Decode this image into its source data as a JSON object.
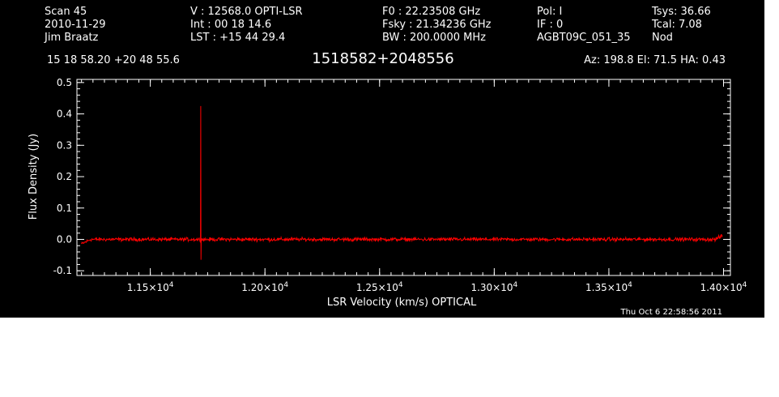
{
  "header": {
    "col1": [
      "Scan          45",
      "2010-11-29",
      "Jim Braatz"
    ],
    "col2": [
      "V   :    12568.0  OPTI-LSR",
      "Int  :   00 18 14.6",
      "LST : +15 44 29.4"
    ],
    "col3": [
      "F0    :  22.23508 GHz",
      "Fsky :  21.34236 GHz",
      "BW    : 200.0000 MHz"
    ],
    "col4": [
      "Pol:      I",
      "IF :       0",
      "AGBT09C_051_35"
    ],
    "col5": [
      "Tsys:    36.66",
      "Tcal:      7.08",
      "Nod"
    ],
    "coords": "15 18 58.20   +20 48 55.6",
    "source": "1518582+2048556",
    "azelha": "Az: 198.8   El:  71.5   HA:  0.43",
    "timestamp": "Thu Oct  6 22:58:56 2011"
  },
  "chart_data": {
    "type": "line",
    "xlabel": "LSR Velocity (km/s) OPTICAL",
    "ylabel": "Flux Density (Jy)",
    "xlim": [
      11180,
      14030
    ],
    "ylim": [
      -0.115,
      0.51
    ],
    "xticks": [
      11500,
      12000,
      12500,
      13000,
      13500,
      14000
    ],
    "xtick_labels": [
      {
        "mant": "1.15×10",
        "exp": "4"
      },
      {
        "mant": "1.20×10",
        "exp": "4"
      },
      {
        "mant": "1.25×10",
        "exp": "4"
      },
      {
        "mant": "1.30×10",
        "exp": "4"
      },
      {
        "mant": "1.35×10",
        "exp": "4"
      },
      {
        "mant": "1.40×10",
        "exp": "4"
      }
    ],
    "yticks": [
      -0.1,
      0.0,
      0.1,
      0.2,
      0.3,
      0.4,
      0.5
    ],
    "ytick_labels": [
      "-0.1",
      "0.0",
      "0.1",
      "0.2",
      "0.3",
      "0.4",
      "0.5"
    ],
    "series": [
      {
        "color": "#ff0000",
        "x_range": [
          11200,
          13995
        ],
        "baseline": 0.0,
        "noise_rms": 0.004,
        "features": [
          {
            "x": 11720,
            "peak": 0.425,
            "trough": -0.065
          },
          {
            "x": 11205,
            "value": -0.015
          },
          {
            "x": 13990,
            "value": 0.012
          }
        ]
      }
    ]
  }
}
